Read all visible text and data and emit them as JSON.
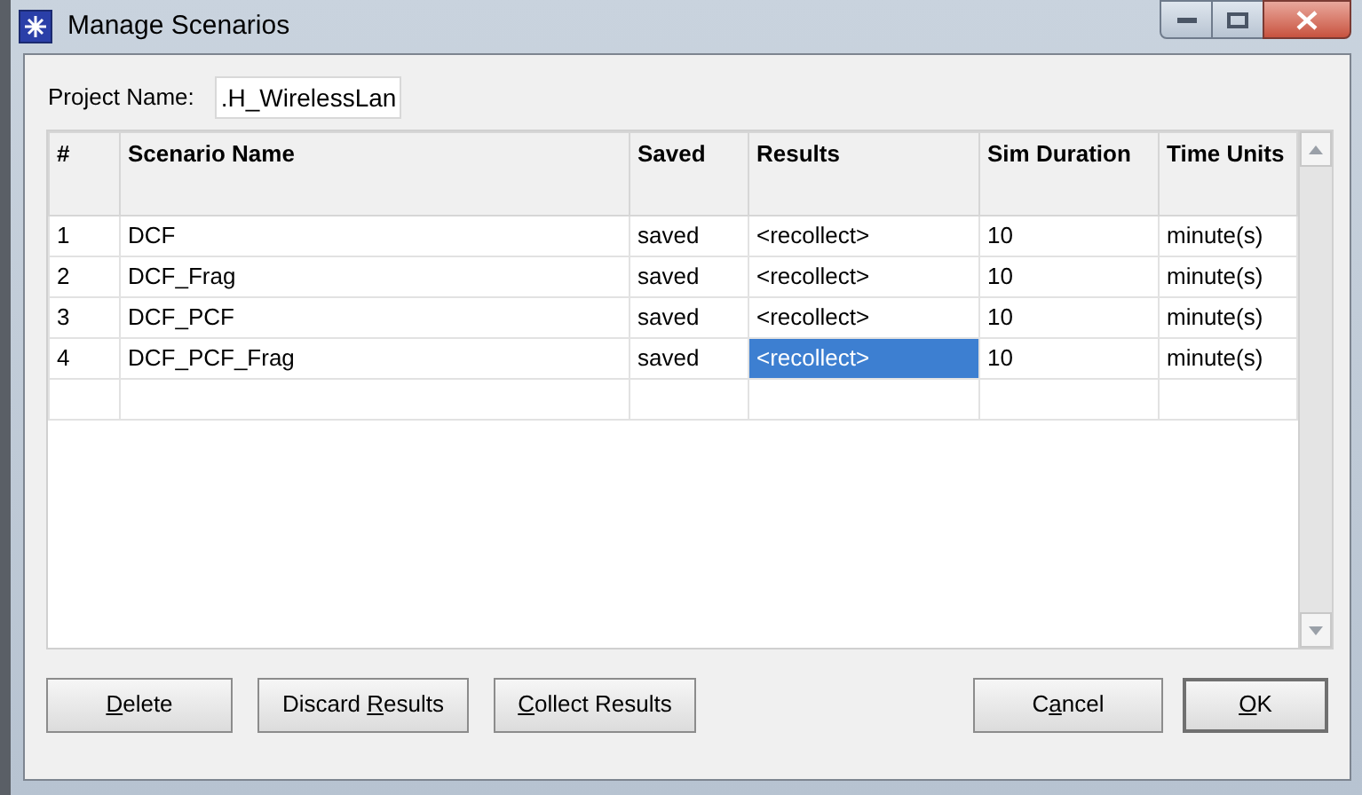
{
  "window": {
    "title": "Manage Scenarios"
  },
  "project_name": {
    "label": "Project Name:",
    "value": ".H_WirelessLan"
  },
  "table": {
    "columns": [
      "#",
      "Scenario Name",
      "Saved",
      "Results",
      "Sim Duration",
      "Time Units"
    ],
    "rows": [
      {
        "number": "1",
        "name": "DCF",
        "saved": "saved",
        "results": {
          "text": "<recollect>",
          "selected": false
        },
        "duration": "10",
        "units": "minute(s)"
      },
      {
        "number": "2",
        "name": "DCF_Frag",
        "saved": "saved",
        "results": {
          "text": "<recollect>",
          "selected": false
        },
        "duration": "10",
        "units": "minute(s)"
      },
      {
        "number": "3",
        "name": "DCF_PCF",
        "saved": "saved",
        "results": {
          "text": "<recollect>",
          "selected": false
        },
        "duration": "10",
        "units": "minute(s)"
      },
      {
        "number": "4",
        "name": "DCF_PCF_Frag",
        "saved": "saved",
        "results": {
          "text": "<recollect>",
          "selected": true
        },
        "duration": "10",
        "units": "minute(s)"
      }
    ]
  },
  "buttons": [
    {
      "key": "D",
      "after": "elete",
      "default": false
    },
    {
      "before": "Discard ",
      "key": "R",
      "after": "esults",
      "default": false
    },
    {
      "key": "C",
      "after": "ollect Results",
      "default": false
    },
    {
      "before": "C",
      "key": "a",
      "after": "ncel",
      "default": false
    },
    {
      "key": "O",
      "after": "K",
      "default": true
    }
  ]
}
